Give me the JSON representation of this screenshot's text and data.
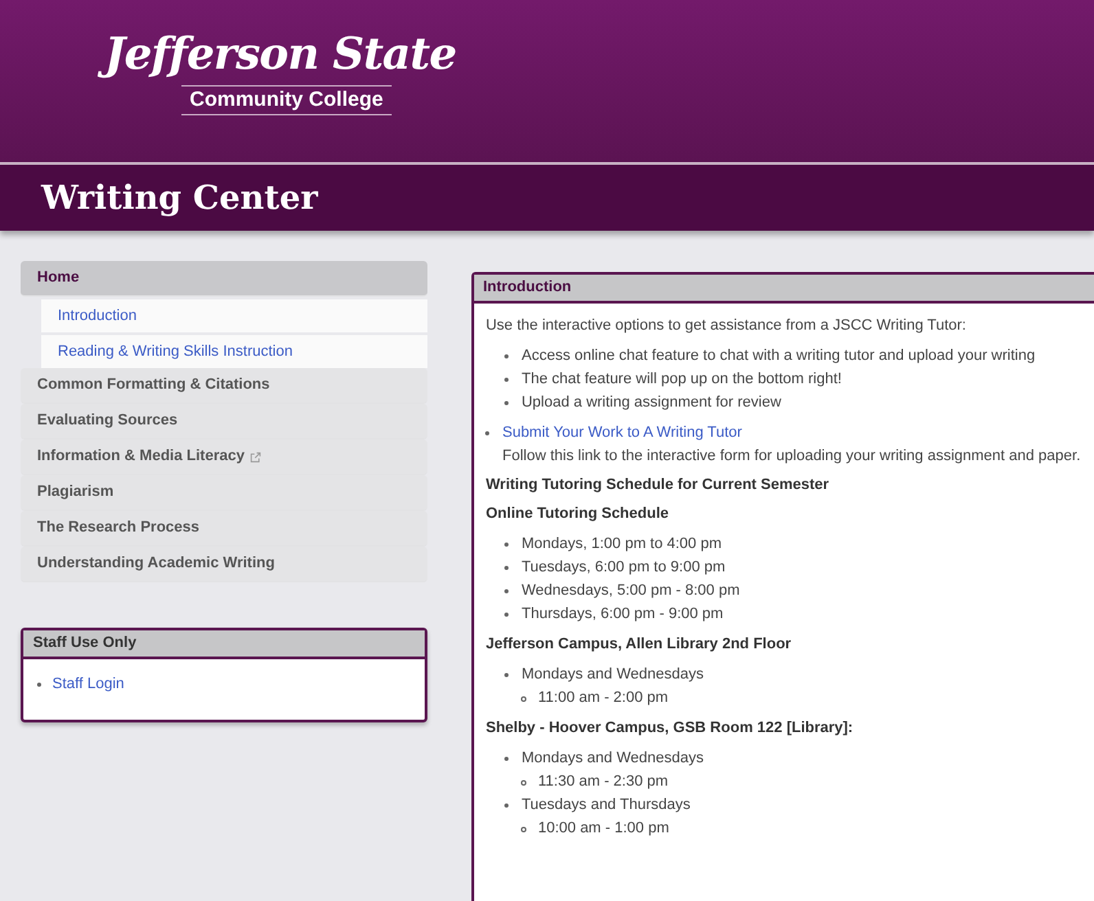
{
  "header": {
    "logo": {
      "script": "Jefferson State",
      "subtitle": "Community College"
    },
    "title": "Writing Center"
  },
  "nav": {
    "items": [
      {
        "label": "Home",
        "selected": true,
        "external": false,
        "children": [
          {
            "label": "Introduction"
          },
          {
            "label": "Reading & Writing Skills Instruction"
          }
        ]
      },
      {
        "label": "Common Formatting & Citations",
        "selected": false,
        "external": false
      },
      {
        "label": "Evaluating Sources",
        "selected": false,
        "external": false
      },
      {
        "label": "Information & Media Literacy",
        "selected": false,
        "external": true
      },
      {
        "label": "Plagiarism",
        "selected": false,
        "external": false
      },
      {
        "label": "The Research Process",
        "selected": false,
        "external": false
      },
      {
        "label": "Understanding Academic Writing",
        "selected": false,
        "external": false
      }
    ]
  },
  "staff_box": {
    "title": "Staff Use Only",
    "links": [
      "Staff Login"
    ]
  },
  "content": {
    "title": "Introduction",
    "blocks": [
      {
        "kind": "paragraph",
        "text": "Use the interactive options to get assistance from a JSCC Writing Tutor:"
      },
      {
        "kind": "list",
        "items": [
          {
            "text": "Access online chat feature to chat with a writing tutor and upload your writing"
          },
          {
            "text": "The chat feature will pop up on the bottom right!"
          },
          {
            "text": "Upload a writing assignment for review"
          }
        ]
      },
      {
        "kind": "link_item",
        "label": "Submit Your Work to A Writing Tutor",
        "description": "Follow this link to the interactive form for uploading your writing assignment and paper."
      },
      {
        "kind": "heading",
        "text": "Writing Tutoring Schedule for Current Semester"
      },
      {
        "kind": "heading",
        "text": "Online Tutoring Schedule"
      },
      {
        "kind": "list",
        "items": [
          {
            "text": "Mondays, 1:00 pm to 4:00 pm"
          },
          {
            "text": "Tuesdays, 6:00 pm to 9:00 pm"
          },
          {
            "text": "Wednesdays, 5:00 pm - 8:00 pm"
          },
          {
            "text": "Thursdays, 6:00 pm - 9:00 pm"
          }
        ]
      },
      {
        "kind": "heading",
        "text": "Jefferson Campus, Allen Library 2nd Floor"
      },
      {
        "kind": "list",
        "items": [
          {
            "text": "Mondays and Wednesdays",
            "children": [
              {
                "text": "11:00 am - 2:00 pm"
              }
            ]
          }
        ]
      },
      {
        "kind": "heading",
        "text": "Shelby - Hoover Campus, GSB Room 122 [Library]:"
      },
      {
        "kind": "list",
        "items": [
          {
            "text": "Mondays and Wednesdays",
            "children": [
              {
                "text": "11:30 am - 2:30 pm"
              }
            ]
          },
          {
            "text": "Tuesdays and Thursdays",
            "children": [
              {
                "text": "10:00 am - 1:00 pm"
              }
            ]
          }
        ]
      }
    ]
  }
}
